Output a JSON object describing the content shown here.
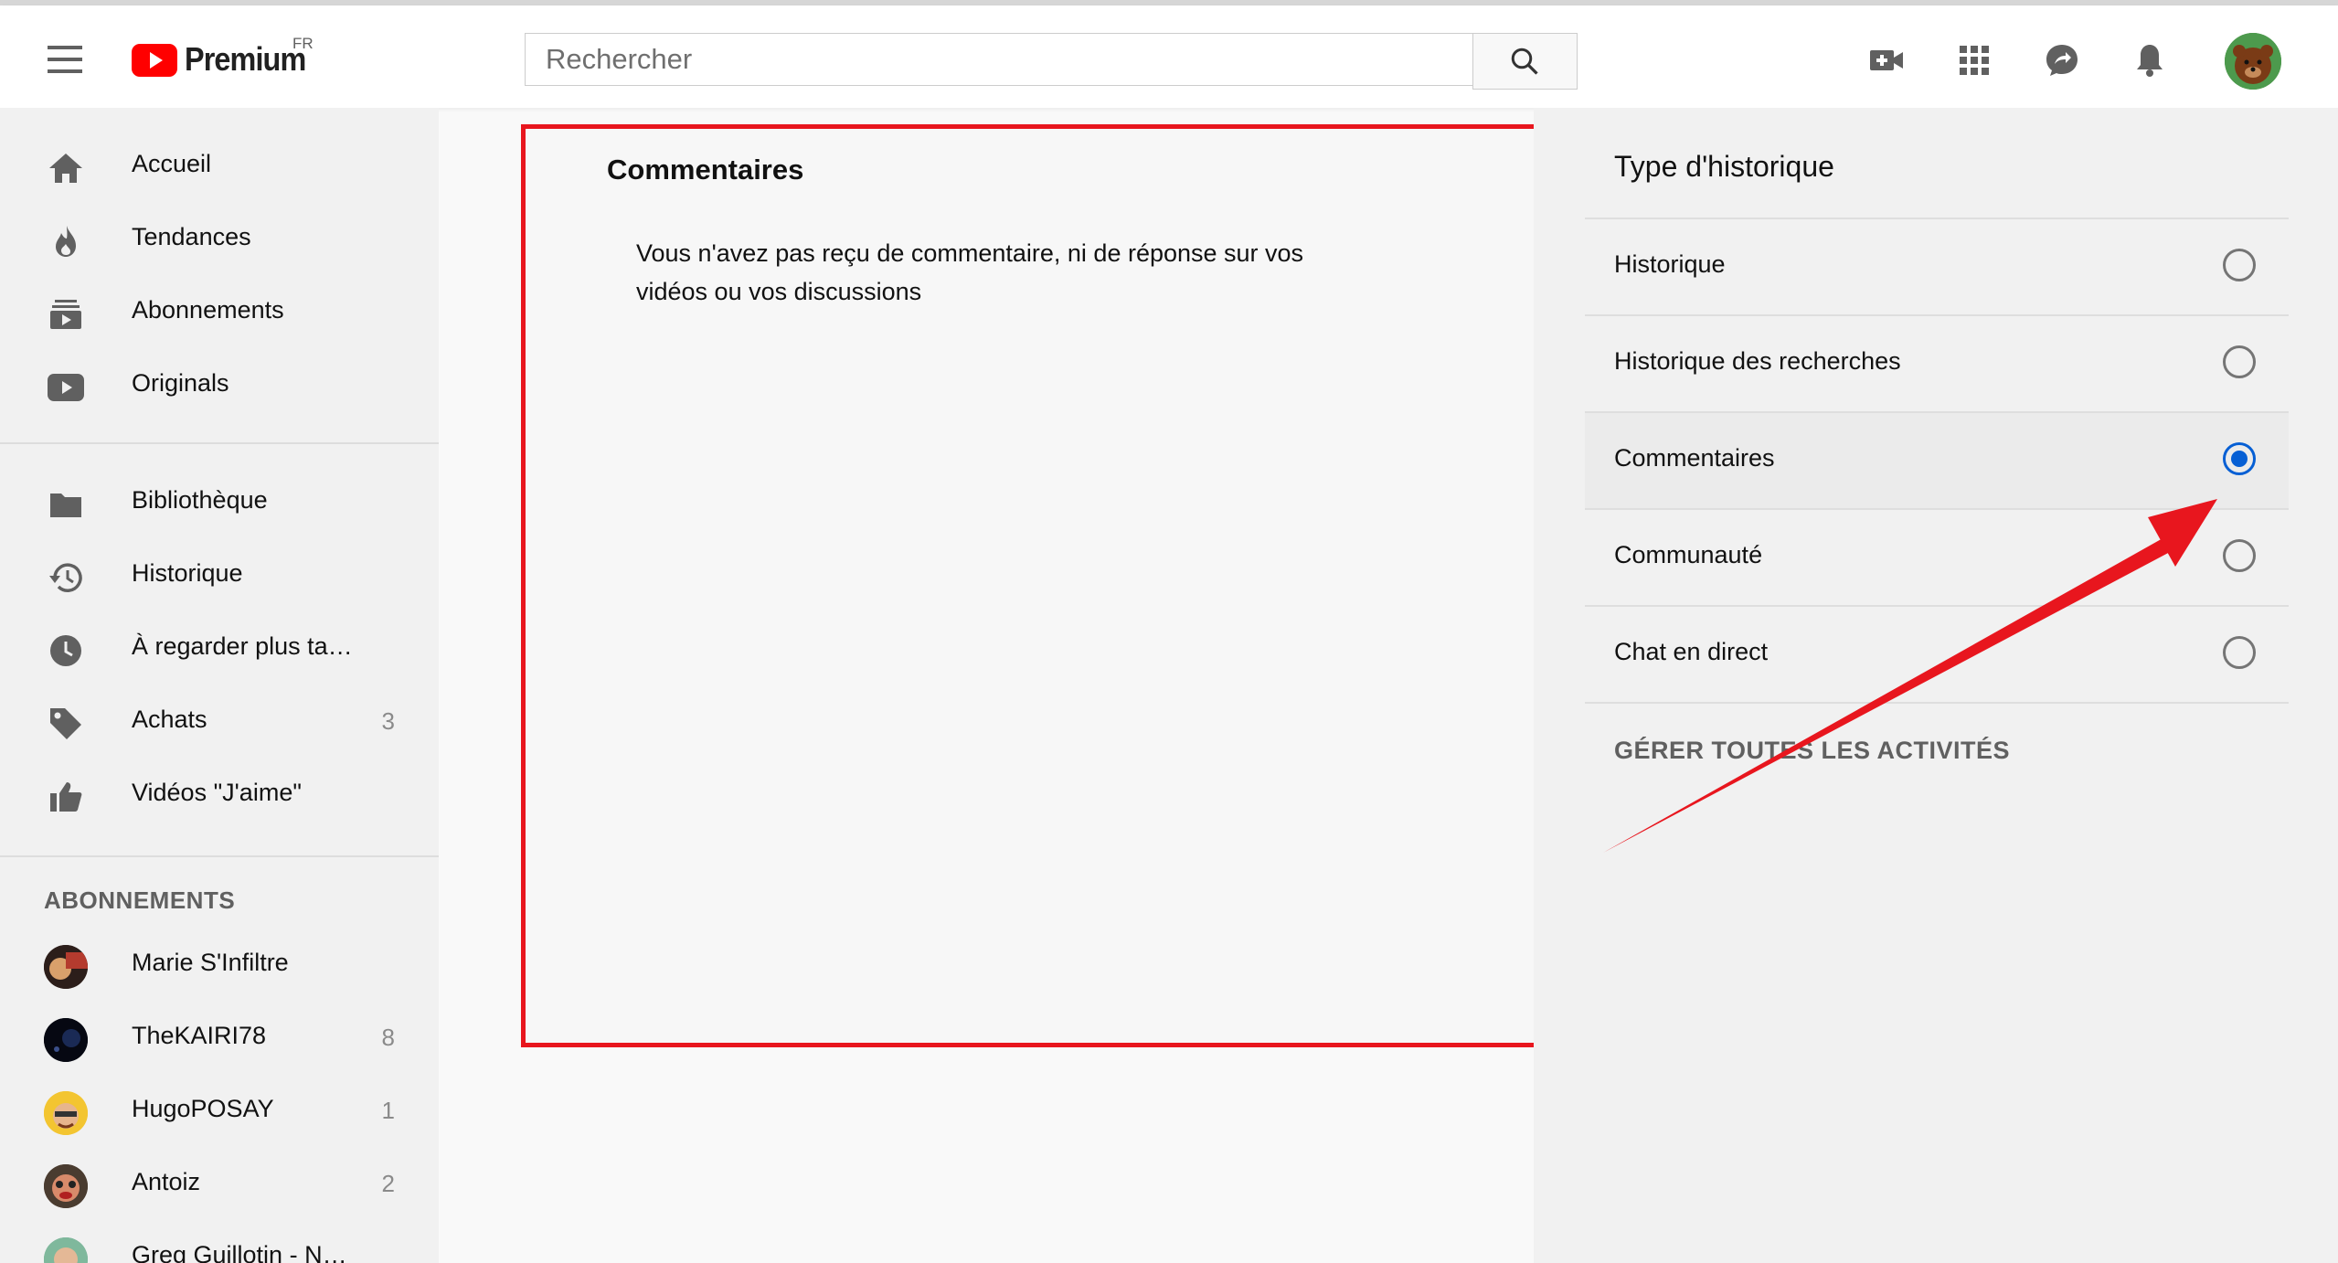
{
  "header": {
    "logo_text": "Premium",
    "region": "FR",
    "search_placeholder": "Rechercher",
    "icons": [
      "menu-icon",
      "youtube-logo",
      "search-icon",
      "create-video-icon",
      "apps-grid-icon",
      "share-messages-icon",
      "notifications-bell-icon",
      "account-avatar"
    ]
  },
  "sidebar": {
    "main_items": [
      {
        "label": "Accueil",
        "icon": "home-icon"
      },
      {
        "label": "Tendances",
        "icon": "trending-flame-icon"
      },
      {
        "label": "Abonnements",
        "icon": "subscriptions-icon"
      },
      {
        "label": "Originals",
        "icon": "originals-play-icon"
      }
    ],
    "library_items": [
      {
        "label": "Bibliothèque",
        "icon": "library-folder-icon",
        "count": ""
      },
      {
        "label": "Historique",
        "icon": "history-icon",
        "count": ""
      },
      {
        "label": "À regarder plus ta…",
        "icon": "watch-later-clock-icon",
        "count": ""
      },
      {
        "label": "Achats",
        "icon": "purchases-tag-icon",
        "count": "3"
      },
      {
        "label": "Vidéos \"J'aime\"",
        "icon": "liked-thumb-icon",
        "count": ""
      }
    ],
    "subscriptions_title": "ABONNEMENTS",
    "subscriptions": [
      {
        "label": "Marie S'Infiltre",
        "count": ""
      },
      {
        "label": "TheKAIRI78",
        "count": "8"
      },
      {
        "label": "HugoPOSAY",
        "count": "1"
      },
      {
        "label": "Antoiz",
        "count": "2"
      },
      {
        "label": "Greg Guillotin - N…",
        "count": ""
      }
    ]
  },
  "main": {
    "title": "Commentaires",
    "message": "Vous n'avez pas reçu de commentaire, ni de réponse sur vos vidéos ou vos discussions"
  },
  "history_panel": {
    "title": "Type d'historique",
    "options": [
      {
        "label": "Historique",
        "selected": false
      },
      {
        "label": "Historique des recherches",
        "selected": false
      },
      {
        "label": "Commentaires",
        "selected": true
      },
      {
        "label": "Communauté",
        "selected": false
      },
      {
        "label": "Chat en direct",
        "selected": false
      }
    ],
    "manage_link": "GÉRER TOUTES LES ACTIVITÉS"
  },
  "colors": {
    "accent": "#065fd4",
    "annotation_red": "#e8161e",
    "youtube_red": "#ff0000"
  }
}
